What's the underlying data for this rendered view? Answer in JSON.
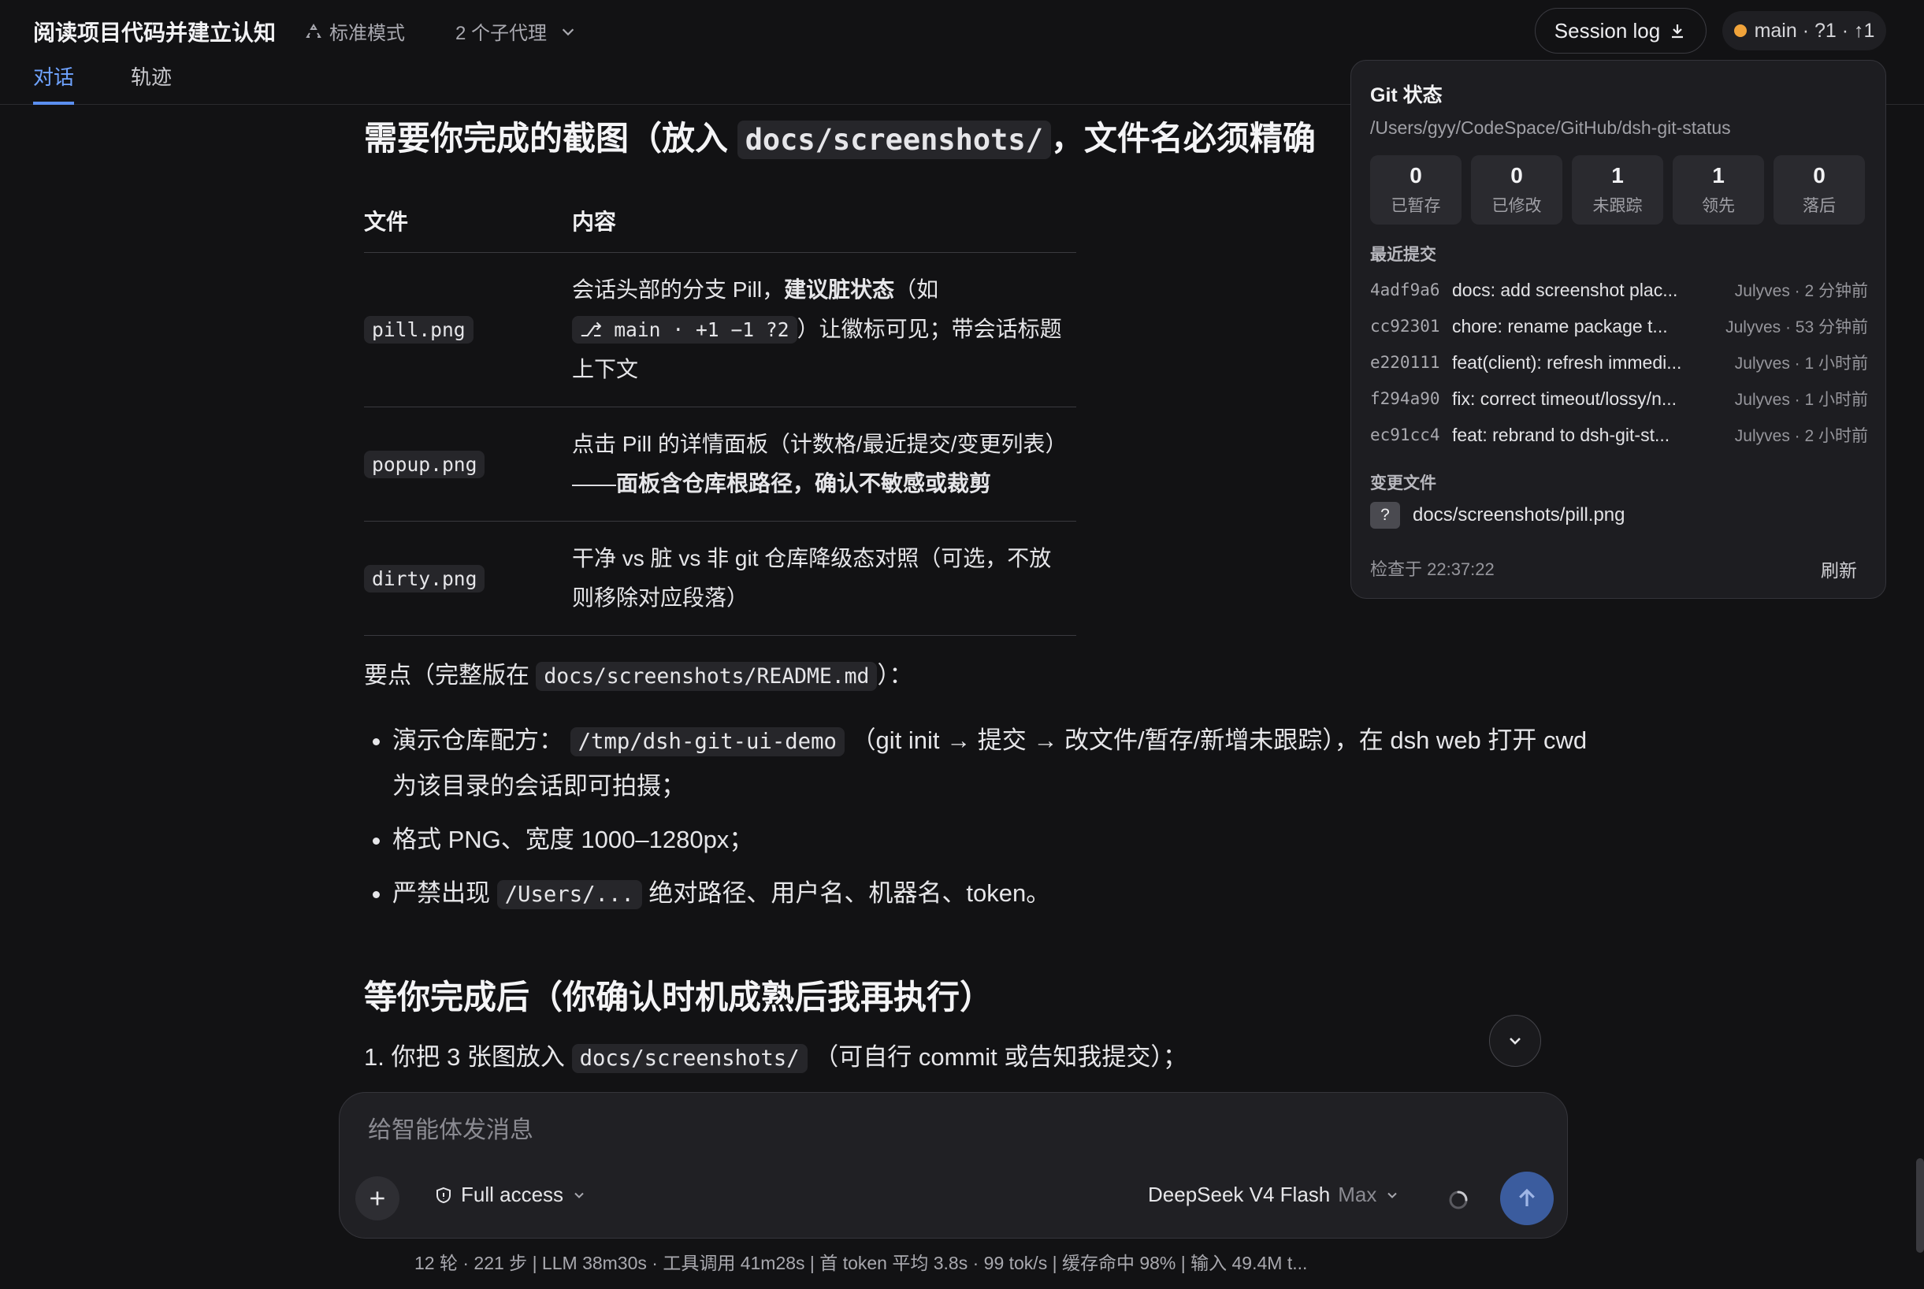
{
  "header": {
    "title": "阅读项目代码并建立认知",
    "mode_label": "标准模式",
    "agents_label": "2 个子代理",
    "tabs": [
      {
        "label": "对话",
        "active": true
      },
      {
        "label": "轨迹",
        "active": false
      }
    ],
    "session_log_label": "Session log",
    "branch_pill": "main · ?1 · ↑1",
    "branch_dot_color": "#f0a33a"
  },
  "content": {
    "heading1_prefix": "需要你完成的截图（放入",
    "heading1_code": "docs/screenshots/",
    "heading1_suffix": "，文件名必须精确",
    "table": {
      "headers": [
        "文件",
        "内容"
      ],
      "rows": [
        {
          "file": "pill.png",
          "desc_1": "会话头部的分支 Pill，",
          "desc_bold": "建议脏状态",
          "desc_2": "（如",
          "desc_code": "⎇ main · +1 −1 ?2",
          "desc_3": "）让徽标可见；带会话标题上下文"
        },
        {
          "file": "popup.png",
          "desc_1": "点击 Pill 的详情面板（计数格/最近提交/变更列表）——",
          "desc_bold": "面板含仓库根路径，确认不敏感或裁剪"
        },
        {
          "file": "dirty.png",
          "desc_1": "干净 vs 脏 vs 非 git 仓库降级态对照（可选，不放则移除对应段落）"
        }
      ]
    },
    "points_prefix": "要点（完整版在",
    "points_code": "docs/screenshots/README.md",
    "points_suffix": "）：",
    "bullets": [
      {
        "pre": "演示仓库配方：",
        "code": "/tmp/dsh-git-ui-demo",
        "post": "（git init → 提交 → 改文件/暂存/新增未跟踪），在 dsh web 打开 cwd 为该目录的会话即可拍摄；"
      },
      {
        "pre": "格式 PNG、宽度 1000–1280px；",
        "code": "",
        "post": ""
      },
      {
        "pre": "严禁出现",
        "code": "/Users/...",
        "post": "绝对路径、用户名、机器名、token。"
      }
    ],
    "heading2": "等你完成后（你确认时机成熟后我再执行）",
    "step1_pre": "1. 你把 3 张图放入",
    "step1_code": "docs/screenshots/",
    "step1_post": "（可自行 commit 或告知我提交）；"
  },
  "git_popover": {
    "title": "Git 状态",
    "path": "/Users/gyy/CodeSpace/GitHub/dsh-git-status",
    "stats": [
      {
        "value": "0",
        "label": "已暂存"
      },
      {
        "value": "0",
        "label": "已修改"
      },
      {
        "value": "1",
        "label": "未跟踪"
      },
      {
        "value": "1",
        "label": "领先"
      },
      {
        "value": "0",
        "label": "落后"
      }
    ],
    "recent_label": "最近提交",
    "commits": [
      {
        "hash": "4adf9a6",
        "msg": "docs: add screenshot plac...",
        "meta": "Julyves · 2 分钟前"
      },
      {
        "hash": "cc92301",
        "msg": "chore: rename package t...",
        "meta": "Julyves · 53 分钟前"
      },
      {
        "hash": "e220111",
        "msg": "feat(client): refresh immedi...",
        "meta": "Julyves · 1 小时前"
      },
      {
        "hash": "f294a90",
        "msg": "fix: correct timeout/lossy/n...",
        "meta": "Julyves · 1 小时前"
      },
      {
        "hash": "ec91cc4",
        "msg": "feat: rebrand to dsh-git-st...",
        "meta": "Julyves · 2 小时前"
      }
    ],
    "changed_label": "变更文件",
    "changed_files": [
      {
        "badge": "?",
        "path": "docs/screenshots/pill.png"
      }
    ],
    "checked_at": "检查于 22:37:22",
    "refresh_label": "刷新"
  },
  "composer": {
    "placeholder": "给智能体发消息",
    "access_label": "Full access",
    "model_name": "DeepSeek V4 Flash",
    "model_variant": "Max"
  },
  "footer": {
    "stats": "12 轮 · 221 步  |  LLM 38m30s · 工具调用 41m28s  |  首 token 平均 3.8s · 99 tok/s  |  缓存命中 98%  |  输入 49.4M t..."
  }
}
